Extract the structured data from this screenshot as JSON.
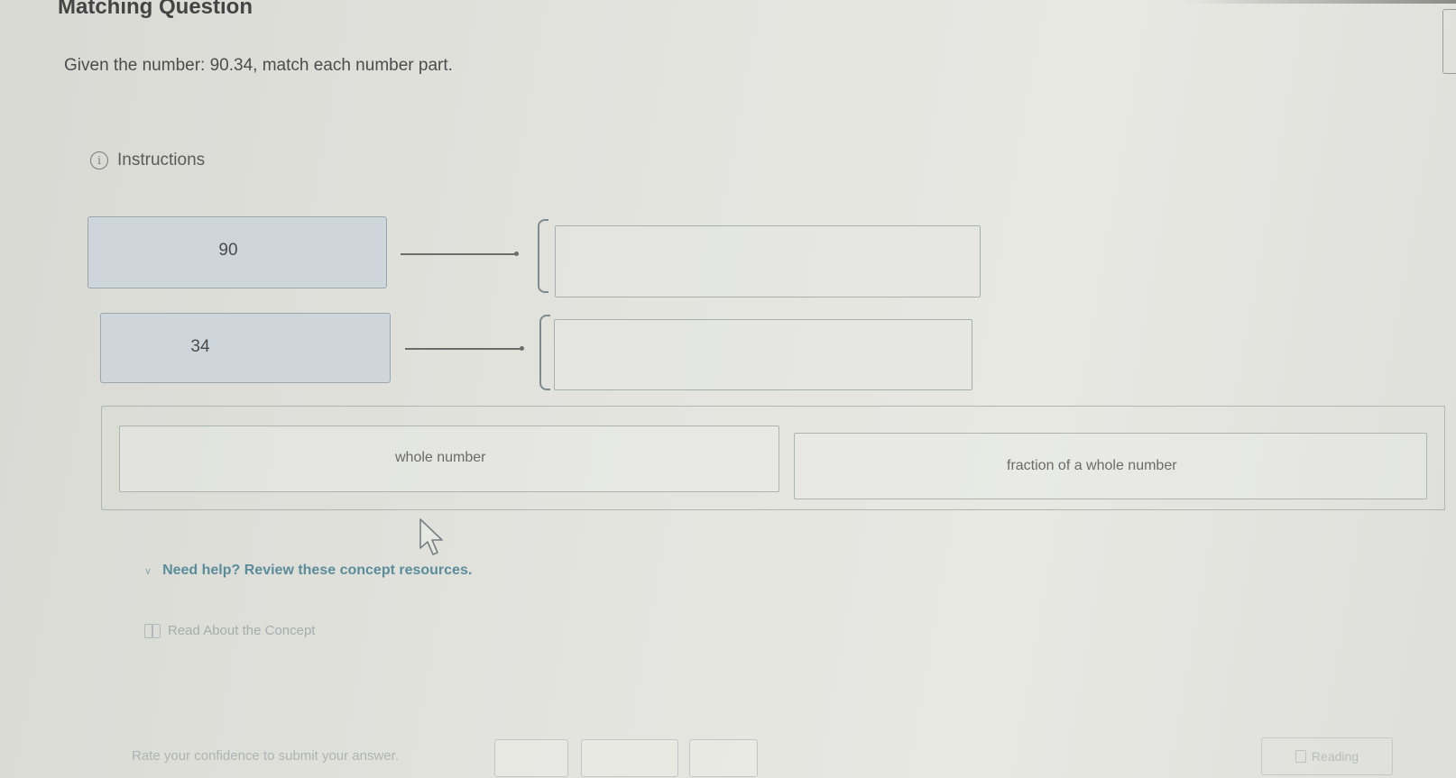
{
  "header": {
    "title": "Matching Question"
  },
  "question": {
    "text": "Given the number: 90.34, match each number part."
  },
  "instructions": {
    "label": "Instructions"
  },
  "matching": {
    "terms": [
      {
        "label": "90"
      },
      {
        "label": "34"
      }
    ],
    "dropzones": [
      {
        "value": ""
      },
      {
        "value": ""
      }
    ]
  },
  "answer_bank": {
    "choices": [
      {
        "label": "whole number"
      },
      {
        "label": "fraction of a whole number"
      }
    ]
  },
  "help": {
    "label": "Need help? Review these concept resources.",
    "resources": [
      {
        "label": "Read About the Concept"
      }
    ]
  },
  "footer": {
    "confidence_label": "Rate your confidence to submit your answer.",
    "reading_label": "Reading"
  },
  "icons": {
    "info": "info-circle-icon",
    "cursor": "mouse-pointer-icon",
    "expand": "chevron-down-icon",
    "resource": "book-icon",
    "reading": "document-icon"
  },
  "colors": {
    "term_fill": "#cfd6db",
    "help_link": "#5b8c9a"
  }
}
